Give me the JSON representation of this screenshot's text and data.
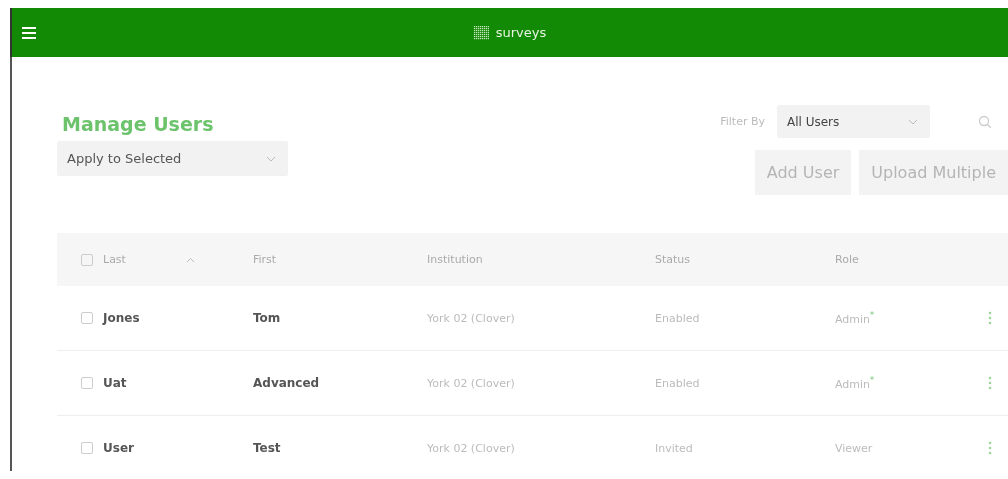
{
  "header": {
    "title": "surveys"
  },
  "page": {
    "title": "Manage Users",
    "bulk_action": {
      "value": "Apply to Selected"
    },
    "filter": {
      "label": "Filter By",
      "value": "All Users"
    },
    "buttons": [
      "Add User",
      "Upload Multiple"
    ]
  },
  "table": {
    "select_all": {
      "checked": false
    },
    "columns": [
      {
        "label": "Last",
        "sorted": true
      },
      {
        "label": "First",
        "sorted": false
      },
      {
        "label": "Institution",
        "sorted": false
      },
      {
        "label": "Status",
        "sorted": false
      },
      {
        "label": "Role",
        "sorted": false
      }
    ],
    "rows": [
      {
        "checked": false,
        "cells": [
          "Jones",
          "Tom",
          "York 02 (Clover)",
          "Enabled",
          "Admin$^{*}$"
        ]
      },
      {
        "checked": false,
        "cells": [
          "Uat",
          "Advanced",
          "York 02 (Clover)",
          "Enabled",
          "Admin$^{*}$"
        ]
      },
      {
        "checked": false,
        "cells": [
          "User",
          "Test",
          "York 02 (Clover)",
          "Invited",
          "Viewer"
        ]
      }
    ]
  }
}
